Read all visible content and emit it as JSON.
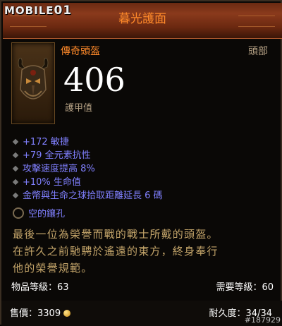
{
  "watermark": {
    "prefix": "MOBILE",
    "suffix": "01"
  },
  "item": {
    "name": "暮光護面",
    "type": "傳奇頭盔",
    "slot": "頭部",
    "armor": "406",
    "armor_label": "護甲值",
    "affixes": [
      "+172 敏捷",
      "+79 全元素抗性",
      "攻擊速度提高 8%",
      "+10% 生命值",
      "金幣與生命之球拾取距離延長 6 碼"
    ],
    "socket": "空的鑲孔",
    "flavor_lines": [
      "最後一位為榮譽而戰的戰士所戴的頭盔。",
      "在許久之前馳騁於遙遠的東方，終身奉行",
      "他的榮譽規範。"
    ],
    "item_level": "物品等級：63",
    "required_level": "需要等級：60",
    "price_label": "售價：3309",
    "durability": "耐久度：34/34"
  },
  "post_id": "#187929",
  "colors": {
    "title": "#ff8a2a",
    "magic_affix": "#8080ff",
    "flavor": "#c4a56a",
    "label": "#b5a184"
  }
}
